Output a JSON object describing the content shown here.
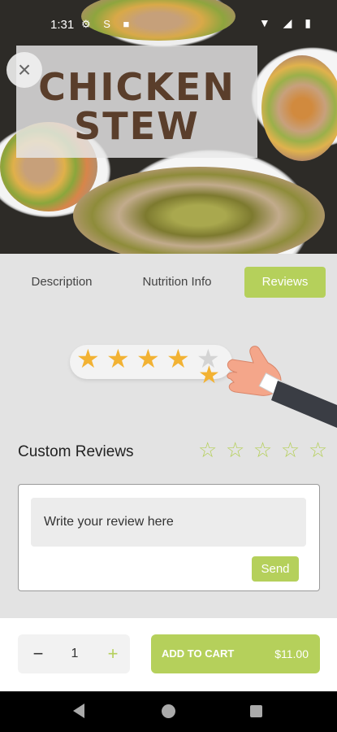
{
  "status_bar": {
    "time": "1:31",
    "left_icons": "⚙ S ■",
    "right_icons": "▼ ◢ ▮"
  },
  "hero": {
    "title_line1": "CHICKEN",
    "title_line2": "STEW",
    "close_icon": "×"
  },
  "tabs": [
    {
      "label": "Description",
      "active": false
    },
    {
      "label": "Nutrition Info",
      "active": false
    },
    {
      "label": "Reviews",
      "active": true
    }
  ],
  "rating_illustration": {
    "filled_stars": 4,
    "total_stars": 5
  },
  "custom_reviews": {
    "label": "Custom Reviews",
    "rating_stars": [
      "☆",
      "☆",
      "☆",
      "☆",
      "☆"
    ],
    "input_placeholder": "Write your review here",
    "send_label": "Send"
  },
  "quantity": {
    "minus": "−",
    "value": "1",
    "plus": "+"
  },
  "cart": {
    "label": "ADD TO CART",
    "price": "$11.00"
  },
  "colors": {
    "accent": "#b5d05b",
    "title_brown": "#5a3e2b",
    "star_gold": "#f2b233"
  }
}
